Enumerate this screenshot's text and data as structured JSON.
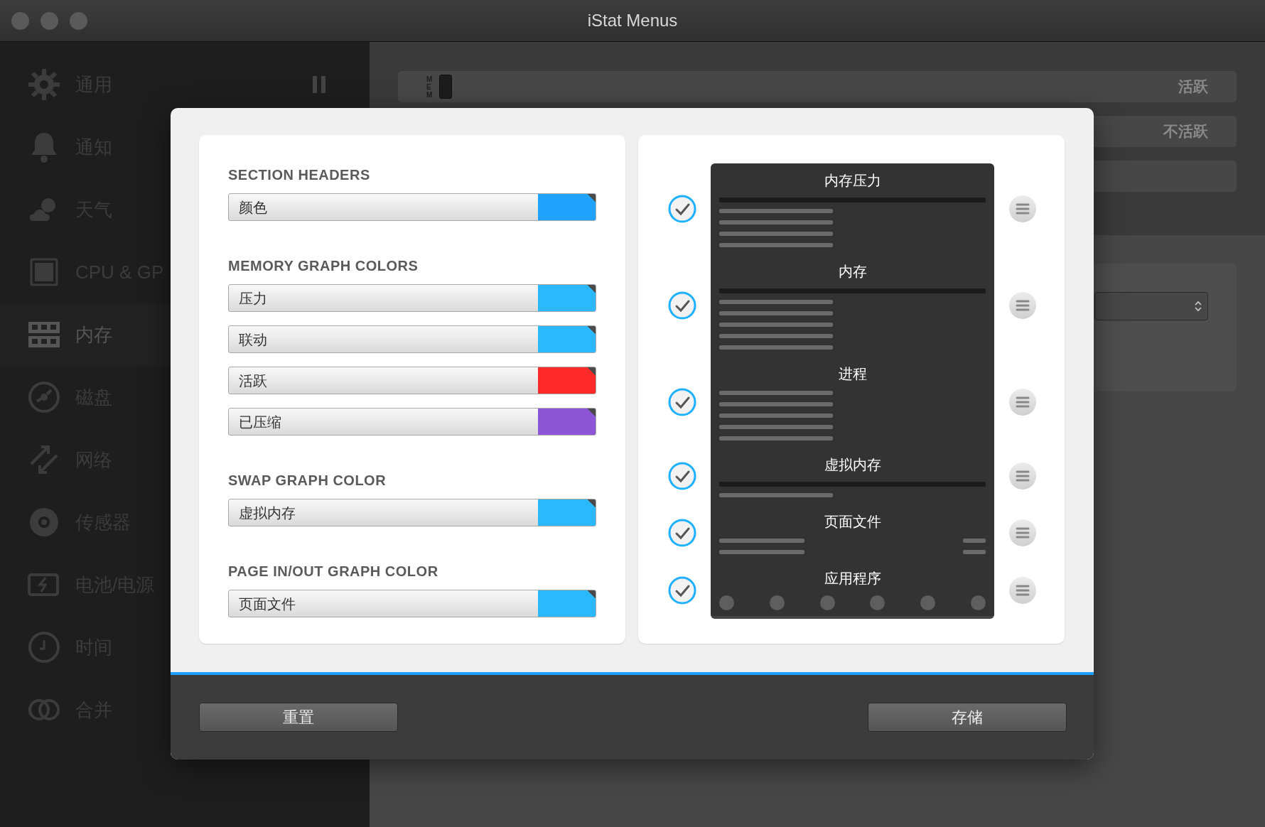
{
  "window": {
    "title": "iStat Menus"
  },
  "sidebar": {
    "items": [
      {
        "label": "通用",
        "selected": false
      },
      {
        "label": "通知",
        "selected": false
      },
      {
        "label": "天气",
        "selected": false
      },
      {
        "label": "CPU & GP",
        "selected": false
      },
      {
        "label": "内存",
        "selected": true
      },
      {
        "label": "磁盘",
        "selected": false
      },
      {
        "label": "网络",
        "selected": false
      },
      {
        "label": "传感器",
        "selected": false
      },
      {
        "label": "电池/电源",
        "selected": false
      },
      {
        "label": "时间",
        "selected": false
      },
      {
        "label": "合并",
        "selected": false
      }
    ]
  },
  "settings": {
    "menu_bar_tag": "MEM",
    "rows": [
      {
        "label": "活跃"
      },
      {
        "label": "不活跃"
      }
    ]
  },
  "dialog": {
    "sections": [
      {
        "header": "SECTION HEADERS",
        "items": [
          {
            "label": "颜色",
            "color": "#1fa3ff"
          }
        ]
      },
      {
        "header": "MEMORY GRAPH COLORS",
        "items": [
          {
            "label": "压力",
            "color": "#2bb8ff"
          },
          {
            "label": "联动",
            "color": "#2bb8ff"
          },
          {
            "label": "活跃",
            "color": "#ff2a2a"
          },
          {
            "label": "已压缩",
            "color": "#8b55d6"
          }
        ]
      },
      {
        "header": "SWAP GRAPH COLOR",
        "items": [
          {
            "label": "虚拟内存",
            "color": "#2bb8ff"
          }
        ]
      },
      {
        "header": "PAGE IN/OUT GRAPH COLOR",
        "items": [
          {
            "label": "页面文件",
            "color": "#2bb8ff"
          }
        ]
      }
    ],
    "preview": [
      {
        "title": "内存压力",
        "kind": "pressure",
        "checked": true
      },
      {
        "title": "内存",
        "kind": "memory",
        "checked": true
      },
      {
        "title": "进程",
        "kind": "processes",
        "checked": true
      },
      {
        "title": "虚拟内存",
        "kind": "swap",
        "checked": true
      },
      {
        "title": "页面文件",
        "kind": "pages",
        "checked": true
      },
      {
        "title": "应用程序",
        "kind": "apps",
        "checked": true
      }
    ],
    "buttons": [
      {
        "label": "重置"
      },
      {
        "label": "存储"
      }
    ]
  }
}
